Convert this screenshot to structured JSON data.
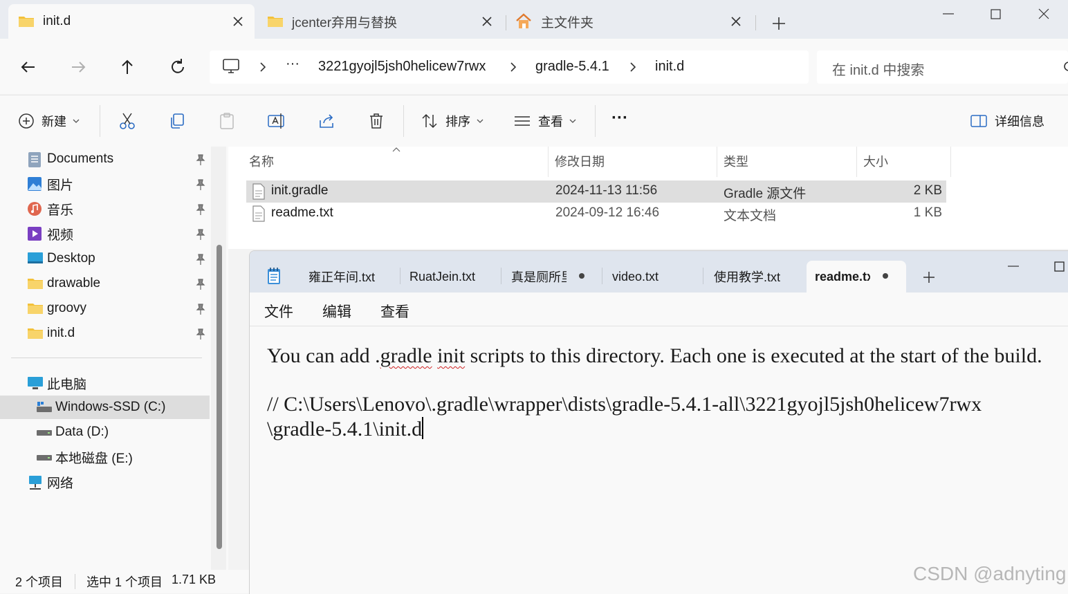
{
  "explorer": {
    "tabs": [
      {
        "label": "init.d",
        "icon": "folder-icon",
        "active": true
      },
      {
        "label": "jcenter弃用与替换",
        "icon": "folder-icon",
        "active": false
      },
      {
        "label": "主文件夹",
        "icon": "home-icon",
        "active": false
      }
    ],
    "new_tab": "+",
    "breadcrumb": [
      "3221gyojl5jsh0helicew7rwx",
      "gradle-5.4.1",
      "init.d"
    ],
    "breadcrumb_ellipsis": "···",
    "search_placeholder": "在 init.d 中搜索",
    "commands": {
      "new": "新建",
      "sort": "排序",
      "view": "查看",
      "more": "···",
      "details": "详细信息"
    },
    "nav_quick": [
      {
        "label": "Documents",
        "icon": "documents-icon"
      },
      {
        "label": "图片",
        "icon": "pictures-icon"
      },
      {
        "label": "音乐",
        "icon": "music-icon"
      },
      {
        "label": "视频",
        "icon": "videos-icon"
      },
      {
        "label": "Desktop",
        "icon": "desktop-icon"
      },
      {
        "label": "drawable",
        "icon": "folder-icon"
      },
      {
        "label": "groovy",
        "icon": "folder-icon"
      },
      {
        "label": "init.d",
        "icon": "folder-icon"
      }
    ],
    "nav_pc": {
      "label": "此电脑",
      "drives": [
        {
          "label": "Windows-SSD (C:)",
          "selected": true
        },
        {
          "label": "Data (D:)",
          "selected": false
        },
        {
          "label": "本地磁盘 (E:)",
          "selected": false
        }
      ],
      "network": "网络"
    },
    "columns": {
      "name": "名称",
      "modified": "修改日期",
      "type": "类型",
      "size": "大小"
    },
    "files": [
      {
        "name": "init.gradle",
        "modified": "2024-11-13 11:56",
        "type": "Gradle 源文件",
        "size": "2 KB",
        "selected": true
      },
      {
        "name": "readme.txt",
        "modified": "2024-09-12 16:46",
        "type": "文本文档",
        "size": "1 KB",
        "selected": false
      }
    ],
    "status": {
      "count": "2 个项目",
      "selection": "选中 1 个项目",
      "size": "1.71 KB"
    }
  },
  "notepad": {
    "tabs": [
      {
        "label": "雍正年间.txt",
        "modified": false
      },
      {
        "label": "RuatJein.txt",
        "modified": false
      },
      {
        "label": "真是厕所里",
        "modified": true
      },
      {
        "label": "video.txt",
        "modified": false
      },
      {
        "label": "使用教学.txt",
        "modified": false
      },
      {
        "label": "readme.txt",
        "modified": true,
        "active": true
      }
    ],
    "new_tab": "+",
    "menu": {
      "file": "文件",
      "edit": "编辑",
      "view": "查看"
    },
    "content": {
      "line1_pre": "You can add .",
      "line1_w1": "gradle",
      "line1_w2": "init",
      "line1_post": " scripts to this directory. Each one is executed at the start of the build.",
      "line2": "// C:\\Users\\Lenovo\\.gradle\\wrapper\\dists\\gradle-5.4.1-all\\3221gyojl5jsh0helicew7rwx",
      "line3": "\\gradle-5.4.1\\init.d"
    }
  },
  "watermark": "CSDN @adnyting",
  "colors": {
    "folder": "#f3c13a",
    "accent": "#0067c0",
    "selected_row": "#dedede"
  }
}
